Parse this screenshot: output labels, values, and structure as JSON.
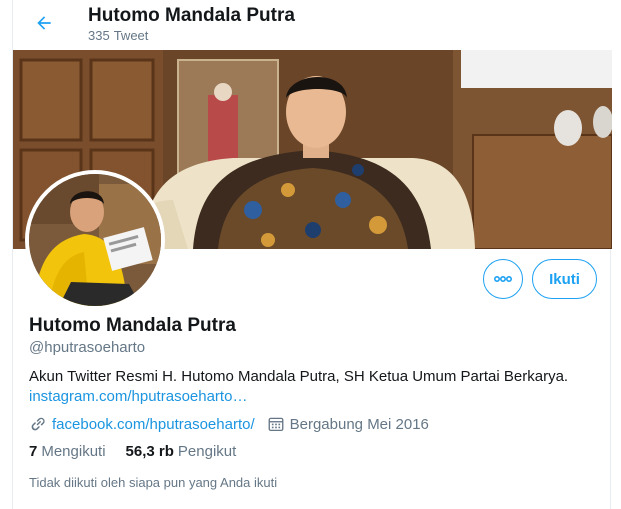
{
  "header": {
    "name": "Hutomo Mandala Putra",
    "tweet_count": "335",
    "tweet_label": "Tweet"
  },
  "profile": {
    "name": "Hutomo Mandala Putra",
    "handle": "@hputrasoeharto",
    "bio": "Akun Twitter Resmi H. Hutomo Mandala Putra, SH Ketua Umum Partai Berkarya.",
    "bio_link": "instagram.com/hputrasoeharto…",
    "website": "facebook.com/hputrasoeharto/",
    "joined": "Bergabung Mei 2016"
  },
  "actions": {
    "follow_label": "Ikuti"
  },
  "stats": {
    "following_count": "7",
    "following_label": "Mengikuti",
    "followers_count": "56,3 rb",
    "followers_label": "Pengikut"
  },
  "note": "Tidak diikuti oleh siapa pun yang Anda ikuti",
  "icons": {
    "back": "arrow-left-icon",
    "more": "more-horizontal-icon",
    "link": "link-icon",
    "calendar": "calendar-icon"
  },
  "colors": {
    "accent": "#1da1f2",
    "link": "#1b95e0",
    "secondary_text": "#657786",
    "primary_text": "#14171a"
  }
}
